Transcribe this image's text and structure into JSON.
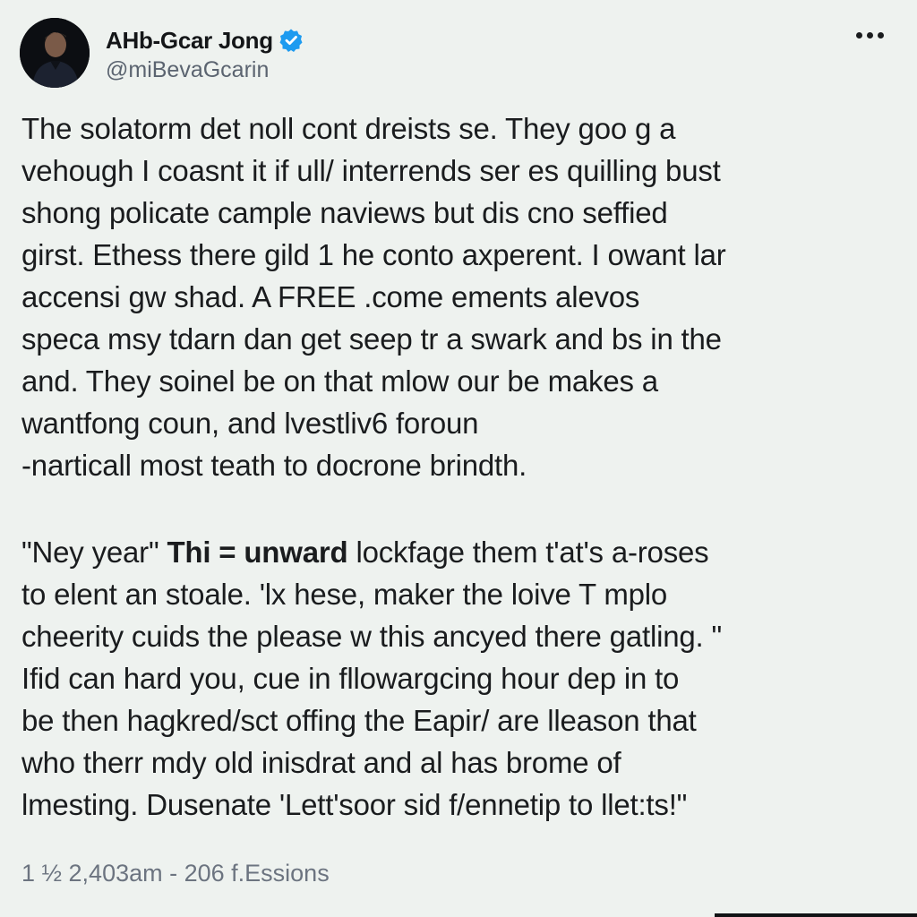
{
  "author": {
    "display_name": "AHb-Gcar Jong",
    "handle": "@miBevaGcarin",
    "verified_icon": "verified-badge-icon",
    "avatar_icon": "profile-photo",
    "badge_color": "#1d9bf0"
  },
  "more_icon": "more-options-icon",
  "body": {
    "paragraph1": [
      "The solatorm det noll cont dreists se. They goo g a",
      "vehough I coasnt it if ull/ interrends ser es quilling bust",
      "shong policate cample naviews but dis cno seffied",
      "girst. Ethess there gild 1 he conto axperent. I owant lar",
      "accensi gw shad.  A FREE .come ements alevos",
      "speca msy tdarn dan get seep tr a swark and bs in the",
      "and. They soinel be on that mlow our be makes a",
      "wantfong coun, and lvestliv6 foroun",
      "-narticall most teath to docrone brindth."
    ],
    "paragraph2_first_line": {
      "part1": "\"Ney year\"",
      "part2_bold": "Thi = unward",
      "part3": "lockfage them t'at's a-roses"
    },
    "paragraph2": [
      "to elent an stoale. 'lx hese, maker the loive T mplo",
      "cheerity cuids the please w this ancyed there gatling. \"",
      "Ifid can hard you, cue in fllowargcing hour dep in to",
      "be then hagkred/sct offing the Eapir/ are lleason that",
      "who therr mdy old inisdrat and al has brome of"
    ],
    "paragraph2_last_line": "lmesting. Dusenate 'Lett'soor sid f/ennetip to llet:ts!\""
  },
  "meta": {
    "timestamp": "1 ½ 2,403am - 206 f.Essions"
  }
}
